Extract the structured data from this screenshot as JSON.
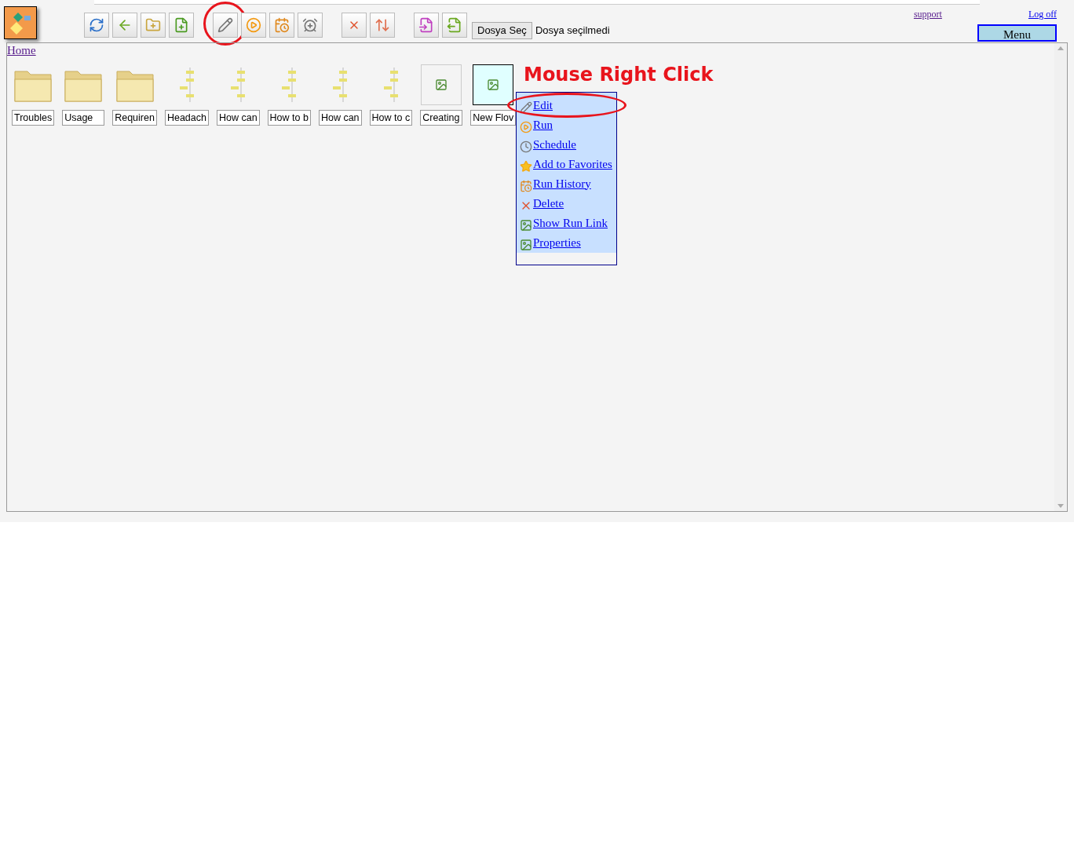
{
  "toolbar": {
    "groups": [
      [
        {
          "kind": "refresh"
        },
        {
          "kind": "back"
        },
        {
          "kind": "new-folder"
        },
        {
          "kind": "new-file"
        }
      ],
      [
        {
          "kind": "edit",
          "circled": true
        },
        {
          "kind": "run"
        },
        {
          "kind": "history"
        },
        {
          "kind": "schedule"
        }
      ],
      [
        {
          "kind": "delete"
        },
        {
          "kind": "move"
        }
      ],
      [
        {
          "kind": "import"
        },
        {
          "kind": "export"
        }
      ]
    ],
    "file_button": "Dosya Seç",
    "file_status": "Dosya seçilmedi"
  },
  "header_links": [
    {
      "label": "support",
      "visited": true
    },
    {
      "label": "Log off",
      "visited": false
    }
  ],
  "menu_button": "Menu",
  "breadcrumb": "Home",
  "items": [
    {
      "kind": "folder",
      "label": "Troubles",
      "selected": false
    },
    {
      "kind": "folder",
      "label": "Usage",
      "selected": false
    },
    {
      "kind": "folder",
      "label": "Requiren",
      "selected": false
    },
    {
      "kind": "flow",
      "label": "Headach",
      "selected": false
    },
    {
      "kind": "flow",
      "label": "How can",
      "selected": false
    },
    {
      "kind": "flow",
      "label": "How to b",
      "selected": false
    },
    {
      "kind": "flow",
      "label": "How can",
      "selected": false
    },
    {
      "kind": "flow",
      "label": "How to c",
      "selected": false
    },
    {
      "kind": "image",
      "label": "Creating",
      "selected": false
    },
    {
      "kind": "image",
      "label": "New Flov",
      "selected": true
    }
  ],
  "annotation": "Mouse Right Click",
  "context_menu": [
    {
      "kind": "edit",
      "label": "Edit",
      "circled": true
    },
    {
      "kind": "run",
      "label": "Run",
      "circled": false
    },
    {
      "kind": "schedule",
      "label": "Schedule",
      "circled": false
    },
    {
      "kind": "favorite",
      "label": "Add to Favorites",
      "circled": false
    },
    {
      "kind": "history",
      "label": "Run History",
      "circled": false
    },
    {
      "kind": "delete",
      "label": "Delete",
      "circled": false
    },
    {
      "kind": "image",
      "label": "Show Run Link",
      "circled": false
    },
    {
      "kind": "image",
      "label": "Properties",
      "circled": false
    }
  ]
}
